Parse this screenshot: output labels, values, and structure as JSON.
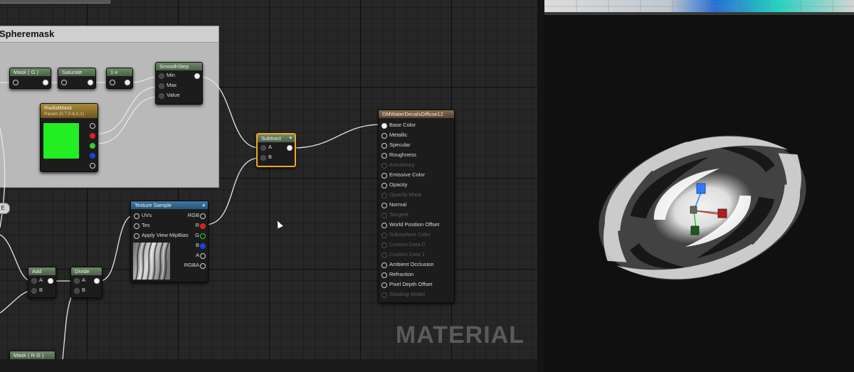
{
  "comment": {
    "title": "Spheremask"
  },
  "nodes": {
    "mask_g": {
      "title": "Mask ( G )"
    },
    "saturate": {
      "title": "Saturate"
    },
    "one_minus": {
      "title": "1-x"
    },
    "smoothstep": {
      "title": "SmoothStep",
      "pins": [
        "Min",
        "Max",
        "Value"
      ]
    },
    "radialmask": {
      "title": "RadialMask",
      "subtitle": "Param (0.7,0.8,0,1)"
    },
    "subtract": {
      "title": "Subtract",
      "pins": [
        "A",
        "B"
      ]
    },
    "texture_sample": {
      "title": "Texture Sample",
      "inputs": [
        "UVs",
        "Tex",
        "Apply View MipBias"
      ],
      "outputs": [
        "RGB",
        "R",
        "G",
        "B",
        "A",
        "RGBA"
      ]
    },
    "add": {
      "title": "Add",
      "pins": [
        "A",
        "B"
      ]
    },
    "divide": {
      "title": "Divide",
      "pins": [
        "A",
        "B"
      ]
    },
    "mask_rg": {
      "title": "Mask ( R G )"
    },
    "reroute": {
      "label": "E"
    }
  },
  "result": {
    "title": "DMWaterDecalsDiffuse12",
    "pins": [
      {
        "label": "Base Color",
        "enabled": true,
        "connected": true
      },
      {
        "label": "Metallic",
        "enabled": true,
        "connected": false
      },
      {
        "label": "Specular",
        "enabled": true,
        "connected": false
      },
      {
        "label": "Roughness",
        "enabled": true,
        "connected": false
      },
      {
        "label": "Anisotropy",
        "enabled": false,
        "connected": false
      },
      {
        "label": "Emissive Color",
        "enabled": true,
        "connected": false
      },
      {
        "label": "Opacity",
        "enabled": true,
        "connected": false
      },
      {
        "label": "Opacity Mask",
        "enabled": false,
        "connected": false
      },
      {
        "label": "Normal",
        "enabled": true,
        "connected": false
      },
      {
        "label": "Tangent",
        "enabled": false,
        "connected": false
      },
      {
        "label": "World Position Offset",
        "enabled": true,
        "connected": false
      },
      {
        "label": "Subsurface Color",
        "enabled": false,
        "connected": false
      },
      {
        "label": "Custom Data 0",
        "enabled": false,
        "connected": false
      },
      {
        "label": "Custom Data 1",
        "enabled": false,
        "connected": false
      },
      {
        "label": "Ambient Occlusion",
        "enabled": true,
        "connected": false
      },
      {
        "label": "Refraction",
        "enabled": true,
        "connected": false
      },
      {
        "label": "Pixel Depth Offset",
        "enabled": true,
        "connected": false
      },
      {
        "label": "Shading Model",
        "enabled": false,
        "connected": false
      }
    ]
  },
  "watermark": "MATERIAL",
  "colors": {
    "selection": "#f5a623",
    "radialmask_preview": "#22ee22",
    "gizmo_x": "#e03030",
    "gizmo_y": "#30c030",
    "gizmo_z": "#2f7bff"
  }
}
